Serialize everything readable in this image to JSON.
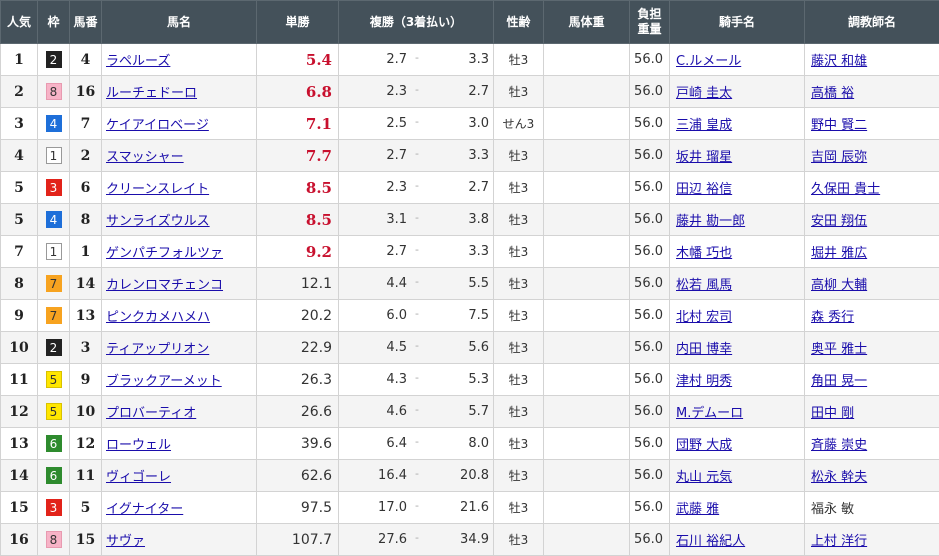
{
  "headers": {
    "pop": "人気",
    "waku": "枠",
    "uma": "馬番",
    "name": "馬名",
    "tan": "単勝",
    "fuku": "複勝（3着払い）",
    "sex": "性齢",
    "weight": "馬体重",
    "kin1": "負担",
    "kin2": "重量",
    "jockey": "騎手名",
    "trainer": "調教師名"
  },
  "place_sep": "-",
  "waku_colors": {
    "1": {
      "bg": "#ffffff",
      "fg": "#333333",
      "border": "#999999"
    },
    "2": {
      "bg": "#222222",
      "fg": "#ffffff",
      "border": "#222222"
    },
    "3": {
      "bg": "#e2231a",
      "fg": "#ffffff",
      "border": "#e2231a"
    },
    "4": {
      "bg": "#1e6fd9",
      "fg": "#ffffff",
      "border": "#1e6fd9"
    },
    "5": {
      "bg": "#ffe600",
      "fg": "#333333",
      "border": "#d9c200"
    },
    "6": {
      "bg": "#2e8b2e",
      "fg": "#ffffff",
      "border": "#2e8b2e"
    },
    "7": {
      "bg": "#f7a320",
      "fg": "#333333",
      "border": "#f7a320"
    },
    "8": {
      "bg": "#f7b3c7",
      "fg": "#333333",
      "border": "#e89ab0"
    }
  },
  "rows": [
    {
      "pop": "1",
      "waku": "2",
      "uma": "4",
      "name": "ラペルーズ",
      "tan": "5.4",
      "hot": true,
      "fmin": "2.7",
      "fmax": "3.3",
      "sex": "牡3",
      "weight": "",
      "kin": "56.0",
      "jockey": "C.ルメール",
      "trainer": "藤沢 和雄",
      "trainer_link": true
    },
    {
      "pop": "2",
      "waku": "8",
      "uma": "16",
      "name": "ルーチェドーロ",
      "tan": "6.8",
      "hot": true,
      "fmin": "2.3",
      "fmax": "2.7",
      "sex": "牡3",
      "weight": "",
      "kin": "56.0",
      "jockey": "戸崎 圭太",
      "trainer": "高橋 裕",
      "trainer_link": true
    },
    {
      "pop": "3",
      "waku": "4",
      "uma": "7",
      "name": "ケイアイロベージ",
      "tan": "7.1",
      "hot": true,
      "fmin": "2.5",
      "fmax": "3.0",
      "sex": "せん3",
      "weight": "",
      "kin": "56.0",
      "jockey": "三浦 皇成",
      "trainer": "野中 賢二",
      "trainer_link": true
    },
    {
      "pop": "4",
      "waku": "1",
      "uma": "2",
      "name": "スマッシャー",
      "tan": "7.7",
      "hot": true,
      "fmin": "2.7",
      "fmax": "3.3",
      "sex": "牡3",
      "weight": "",
      "kin": "56.0",
      "jockey": "坂井 瑠星",
      "trainer": "吉岡 辰弥",
      "trainer_link": true
    },
    {
      "pop": "5",
      "waku": "3",
      "uma": "6",
      "name": "クリーンスレイト",
      "tan": "8.5",
      "hot": true,
      "fmin": "2.3",
      "fmax": "2.7",
      "sex": "牡3",
      "weight": "",
      "kin": "56.0",
      "jockey": "田辺 裕信",
      "trainer": "久保田 貴士",
      "trainer_link": true
    },
    {
      "pop": "5",
      "waku": "4",
      "uma": "8",
      "name": "サンライズウルス",
      "tan": "8.5",
      "hot": true,
      "fmin": "3.1",
      "fmax": "3.8",
      "sex": "牡3",
      "weight": "",
      "kin": "56.0",
      "jockey": "藤井 勘一郎",
      "trainer": "安田 翔伍",
      "trainer_link": true
    },
    {
      "pop": "7",
      "waku": "1",
      "uma": "1",
      "name": "ゲンパチフォルツァ",
      "tan": "9.2",
      "hot": true,
      "fmin": "2.7",
      "fmax": "3.3",
      "sex": "牡3",
      "weight": "",
      "kin": "56.0",
      "jockey": "木幡 巧也",
      "trainer": "堀井 雅広",
      "trainer_link": true
    },
    {
      "pop": "8",
      "waku": "7",
      "uma": "14",
      "name": "カレンロマチェンコ",
      "tan": "12.1",
      "hot": false,
      "fmin": "4.4",
      "fmax": "5.5",
      "sex": "牡3",
      "weight": "",
      "kin": "56.0",
      "jockey": "松若 風馬",
      "trainer": "高柳 大輔",
      "trainer_link": true
    },
    {
      "pop": "9",
      "waku": "7",
      "uma": "13",
      "name": "ピンクカメハメハ",
      "tan": "20.2",
      "hot": false,
      "fmin": "6.0",
      "fmax": "7.5",
      "sex": "牡3",
      "weight": "",
      "kin": "56.0",
      "jockey": "北村 宏司",
      "trainer": "森 秀行",
      "trainer_link": true
    },
    {
      "pop": "10",
      "waku": "2",
      "uma": "3",
      "name": "ティアップリオン",
      "tan": "22.9",
      "hot": false,
      "fmin": "4.5",
      "fmax": "5.6",
      "sex": "牡3",
      "weight": "",
      "kin": "56.0",
      "jockey": "内田 博幸",
      "trainer": "奥平 雅士",
      "trainer_link": true
    },
    {
      "pop": "11",
      "waku": "5",
      "uma": "9",
      "name": "ブラックアーメット",
      "tan": "26.3",
      "hot": false,
      "fmin": "4.3",
      "fmax": "5.3",
      "sex": "牡3",
      "weight": "",
      "kin": "56.0",
      "jockey": "津村 明秀",
      "trainer": "角田 晃一",
      "trainer_link": true
    },
    {
      "pop": "12",
      "waku": "5",
      "uma": "10",
      "name": "プロバーティオ",
      "tan": "26.6",
      "hot": false,
      "fmin": "4.6",
      "fmax": "5.7",
      "sex": "牡3",
      "weight": "",
      "kin": "56.0",
      "jockey": "M.デムーロ",
      "trainer": "田中 剛",
      "trainer_link": true
    },
    {
      "pop": "13",
      "waku": "6",
      "uma": "12",
      "name": "ローウェル",
      "tan": "39.6",
      "hot": false,
      "fmin": "6.4",
      "fmax": "8.0",
      "sex": "牡3",
      "weight": "",
      "kin": "56.0",
      "jockey": "団野 大成",
      "trainer": "斉藤 崇史",
      "trainer_link": true
    },
    {
      "pop": "14",
      "waku": "6",
      "uma": "11",
      "name": "ヴィゴーレ",
      "tan": "62.6",
      "hot": false,
      "fmin": "16.4",
      "fmax": "20.8",
      "sex": "牡3",
      "weight": "",
      "kin": "56.0",
      "jockey": "丸山 元気",
      "trainer": "松永 幹夫",
      "trainer_link": true
    },
    {
      "pop": "15",
      "waku": "3",
      "uma": "5",
      "name": "イグナイター",
      "tan": "97.5",
      "hot": false,
      "fmin": "17.0",
      "fmax": "21.6",
      "sex": "牡3",
      "weight": "",
      "kin": "56.0",
      "jockey": "武藤 雅",
      "trainer": "福永 敏",
      "trainer_link": false
    },
    {
      "pop": "16",
      "waku": "8",
      "uma": "15",
      "name": "サヴァ",
      "tan": "107.7",
      "hot": false,
      "fmin": "27.6",
      "fmax": "34.9",
      "sex": "牡3",
      "weight": "",
      "kin": "56.0",
      "jockey": "石川 裕紀人",
      "trainer": "上村 洋行",
      "trainer_link": true
    }
  ]
}
